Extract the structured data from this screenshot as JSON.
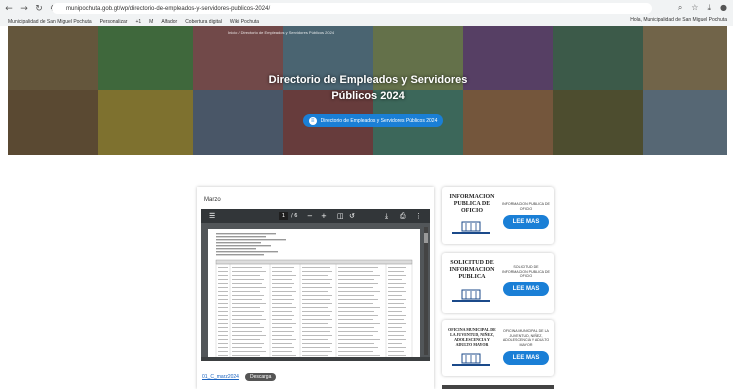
{
  "browser": {
    "url": "munipochuta.gob.gt/wp/directorio-de-empleados-y-servidores-publicos-2024/",
    "bookmarks": [
      "Municipalidad de San Miguel Pochuta",
      "Personalizar",
      "+1",
      "M",
      "Alfador",
      "Cobertura digital",
      "Wiki Pochuta"
    ],
    "bookmark_right": "Hola, Municipalidad de San Miguel Pochuta"
  },
  "hero": {
    "title_line1": "Directorio de Empleados y Servidores",
    "title_line2": "Públicos 2024",
    "button_label": "Directorio de Empleados y Servidores Públicos 2024",
    "crumb": "Inicio / Directorio de Empleados y Servidores Públicos 2024"
  },
  "pdf_card": {
    "title": "Marzo",
    "page_current": "1",
    "page_total": "/ 6",
    "footer_link": "01_C_marz2024",
    "download_label": "Descarga"
  },
  "sidebar": [
    {
      "title": "INFORMACION PUBLICA DE OFICIO",
      "desc": "INFORMACION PUBLICA DE OFICIO",
      "button": "LEE MAS"
    },
    {
      "title": "SOLICITUD DE INFORMACION PUBLICA",
      "desc": "SOLICITUD DE INFORMACION PUBLICA DE OFICIO",
      "button": "LEE MAS"
    },
    {
      "title": "OFICINA MUNICIPAL DE LA JUVENTUD, NIÑEZ, ADOLESCENCIA Y ADULTO MAYOR",
      "desc": "OFICINA MUNICIPAL DE LA JUVENTUD, NIÑEZ, ADOLESCENCIA Y ADULTO MAYOR",
      "button": "LEE MAS"
    }
  ],
  "colors": {
    "accent": "#1a7fd6",
    "toolbar": "#323639",
    "chrome": "#f1f3f4"
  }
}
